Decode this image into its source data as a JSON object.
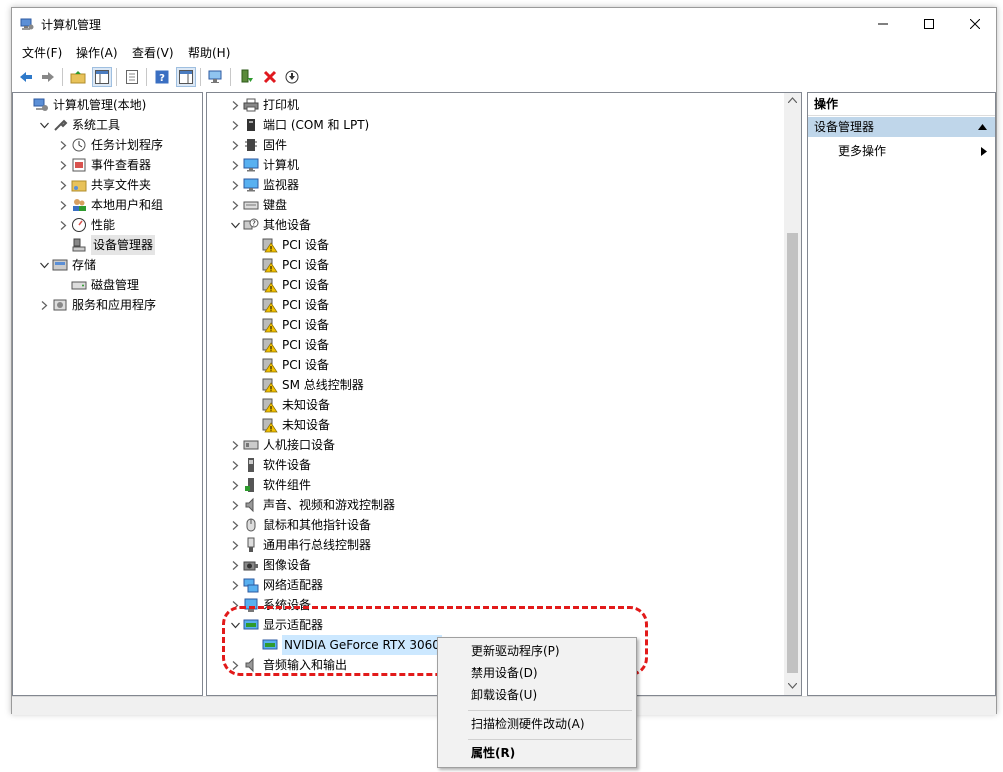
{
  "window": {
    "title": "计算机管理",
    "menu": [
      "文件(F)",
      "操作(A)",
      "查看(V)",
      "帮助(H)"
    ]
  },
  "left_tree": [
    {
      "label": "计算机管理(本地)",
      "arrow": "none",
      "level": 0,
      "icon": "computer-management-icon"
    },
    {
      "label": "系统工具",
      "arrow": "down",
      "level": 1,
      "icon": "system-tools-icon"
    },
    {
      "label": "任务计划程序",
      "arrow": "right",
      "level": 2,
      "icon": "task-scheduler-icon"
    },
    {
      "label": "事件查看器",
      "arrow": "right",
      "level": 2,
      "icon": "event-viewer-icon"
    },
    {
      "label": "共享文件夹",
      "arrow": "right",
      "level": 2,
      "icon": "shared-folder-icon"
    },
    {
      "label": "本地用户和组",
      "arrow": "right",
      "level": 2,
      "icon": "users-icon"
    },
    {
      "label": "性能",
      "arrow": "right",
      "level": 2,
      "icon": "performance-icon"
    },
    {
      "label": "设备管理器",
      "arrow": "none",
      "level": 2,
      "icon": "device-manager-icon",
      "selected": true
    },
    {
      "label": "存储",
      "arrow": "down",
      "level": 1,
      "icon": "storage-icon"
    },
    {
      "label": "磁盘管理",
      "arrow": "none",
      "level": 2,
      "icon": "disk-icon"
    },
    {
      "label": "服务和应用程序",
      "arrow": "right",
      "level": 1,
      "icon": "services-icon"
    }
  ],
  "device_tree": [
    {
      "label": "打印机",
      "arrow": "right",
      "level": 0,
      "icon": "printer-icon"
    },
    {
      "label": "端口 (COM 和 LPT)",
      "arrow": "right",
      "level": 0,
      "icon": "port-icon"
    },
    {
      "label": "固件",
      "arrow": "right",
      "level": 0,
      "icon": "firmware-icon"
    },
    {
      "label": "计算机",
      "arrow": "right",
      "level": 0,
      "icon": "computer-icon"
    },
    {
      "label": "监视器",
      "arrow": "right",
      "level": 0,
      "icon": "monitor-icon"
    },
    {
      "label": "键盘",
      "arrow": "right",
      "level": 0,
      "icon": "keyboard-icon"
    },
    {
      "label": "其他设备",
      "arrow": "down",
      "level": 0,
      "icon": "unknown-device-icon"
    },
    {
      "label": "PCI 设备",
      "arrow": "none",
      "level": 1,
      "icon": "warning-device-icon"
    },
    {
      "label": "PCI 设备",
      "arrow": "none",
      "level": 1,
      "icon": "warning-device-icon"
    },
    {
      "label": "PCI 设备",
      "arrow": "none",
      "level": 1,
      "icon": "warning-device-icon"
    },
    {
      "label": "PCI 设备",
      "arrow": "none",
      "level": 1,
      "icon": "warning-device-icon"
    },
    {
      "label": "PCI 设备",
      "arrow": "none",
      "level": 1,
      "icon": "warning-device-icon"
    },
    {
      "label": "PCI 设备",
      "arrow": "none",
      "level": 1,
      "icon": "warning-device-icon"
    },
    {
      "label": "PCI 设备",
      "arrow": "none",
      "level": 1,
      "icon": "warning-device-icon"
    },
    {
      "label": "SM 总线控制器",
      "arrow": "none",
      "level": 1,
      "icon": "warning-device-icon"
    },
    {
      "label": "未知设备",
      "arrow": "none",
      "level": 1,
      "icon": "warning-device-icon"
    },
    {
      "label": "未知设备",
      "arrow": "none",
      "level": 1,
      "icon": "warning-device-icon"
    },
    {
      "label": "人机接口设备",
      "arrow": "right",
      "level": 0,
      "icon": "hid-icon"
    },
    {
      "label": "软件设备",
      "arrow": "right",
      "level": 0,
      "icon": "software-device-icon"
    },
    {
      "label": "软件组件",
      "arrow": "right",
      "level": 0,
      "icon": "software-component-icon"
    },
    {
      "label": "声音、视频和游戏控制器",
      "arrow": "right",
      "level": 0,
      "icon": "speaker-icon"
    },
    {
      "label": "鼠标和其他指针设备",
      "arrow": "right",
      "level": 0,
      "icon": "mouse-icon"
    },
    {
      "label": "通用串行总线控制器",
      "arrow": "right",
      "level": 0,
      "icon": "usb-icon"
    },
    {
      "label": "图像设备",
      "arrow": "right",
      "level": 0,
      "icon": "camera-icon"
    },
    {
      "label": "网络适配器",
      "arrow": "right",
      "level": 0,
      "icon": "network-adapter-icon"
    },
    {
      "label": "系统设备",
      "arrow": "right",
      "level": 0,
      "icon": "system-device-icon"
    },
    {
      "label": "显示适配器",
      "arrow": "down",
      "level": 0,
      "icon": "display-adapter-icon"
    },
    {
      "label": "NVIDIA GeForce RTX 3060",
      "arrow": "none",
      "level": 1,
      "icon": "display-adapter-icon",
      "selected": true
    },
    {
      "label": "音频输入和输出",
      "arrow": "right",
      "level": 0,
      "icon": "speaker-icon"
    }
  ],
  "actions": {
    "header": "操作",
    "category": "设备管理器",
    "more": "更多操作"
  },
  "context_menu": [
    "更新驱动程序(P)",
    "禁用设备(D)",
    "卸载设备(U)",
    "扫描检测硬件改动(A)",
    "属性(R)"
  ],
  "colors": {
    "highlight": "#e21a1a",
    "selection": "#cce8ff",
    "warning": "#f2c200"
  }
}
